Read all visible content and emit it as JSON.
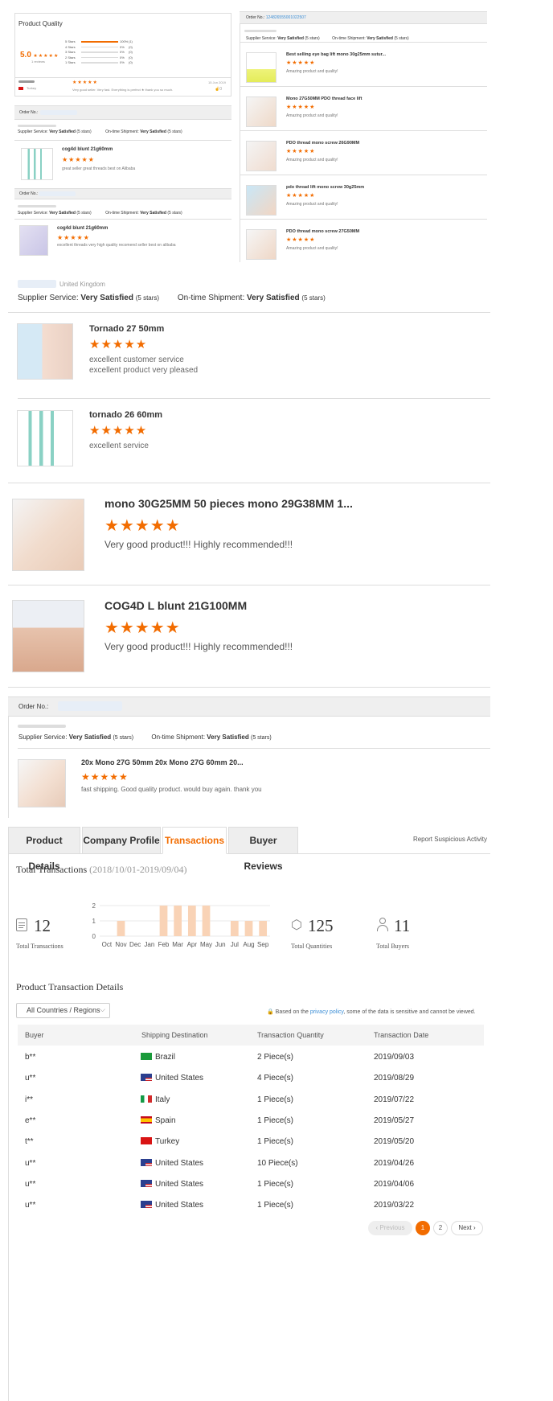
{
  "quality": {
    "title": "Product Quality",
    "score": "5.0",
    "stars": "★★★★★",
    "count": "1 reviews",
    "bars": [
      {
        "label": "5 Stars",
        "pct": "100%",
        "count": "(1)",
        "fill": 1.0
      },
      {
        "label": "4 Stars",
        "pct": "0%",
        "count": "(0)",
        "fill": 0
      },
      {
        "label": "3 Stars",
        "pct": "0%",
        "count": "(0)",
        "fill": 0
      },
      {
        "label": "2 Stars",
        "pct": "0%",
        "count": "(0)",
        "fill": 0
      },
      {
        "label": "1 Stars",
        "pct": "0%",
        "count": "(0)",
        "fill": 0
      }
    ],
    "review_stars": "★★★★★",
    "review_text": "Very good seller. Very fast. Everything is perfect ★ thank you so much.",
    "review_country": "Turkey",
    "review_date": "15 Jun 2019",
    "review_likes": "0"
  },
  "left_orders": [
    {
      "order_label": "Order No.:",
      "supplier_label": "Supplier Service:",
      "supplier_value": "Very Satisfied",
      "supplier_stars": "(5 stars)",
      "ship_label": "On-time Shipment:",
      "ship_value": "Very Satisfied",
      "ship_stars": "(5 stars)",
      "product": "cog4d blunt 21g60mm",
      "stars": "★★★★★",
      "text": "great seller great threads  best on Alibaba"
    },
    {
      "order_label": "Order No.:",
      "supplier_label": "Supplier Service:",
      "supplier_value": "Very Satisfied",
      "supplier_stars": "(5 stars)",
      "ship_label": "On-time Shipment:",
      "ship_value": "Very Satisfied",
      "ship_stars": "(5 stars)",
      "product": "cog4d blunt 21g60mm",
      "stars": "★★★★★",
      "text": "excellent threads very high quality recomend seller best on alibaba"
    }
  ],
  "right_order": {
    "order_label": "Order No.:",
    "order_number": "124826555001022507",
    "supplier_label": "Supplier Service:",
    "supplier_value": "Very Satisfied",
    "supplier_stars": "(5 stars)",
    "ship_label": "On-time Shipment:",
    "ship_value": "Very Satisfied",
    "ship_stars": "(5 stars)",
    "items": [
      {
        "product": "Best selling eye bag lift mono 30g25mm sutur...",
        "stars": "★★★★★",
        "text": "Amazing product and quality!"
      },
      {
        "product": "Mono 27G50MM PDO thread face lift",
        "stars": "★★★★★",
        "text": "Amazing product and quality!"
      },
      {
        "product": "PDO thread mono screw 26G90MM",
        "stars": "★★★★★",
        "text": "Amazing product and quality!"
      },
      {
        "product": "pdo thread lift mono screw 30g25mm",
        "stars": "★★★★★",
        "text": "Amazing product and quality!"
      },
      {
        "product": "PDO thread mono screw 27G50MM",
        "stars": "★★★★★",
        "text": "Amazing product and quality!"
      }
    ]
  },
  "uk_review": {
    "country": "United Kingdom",
    "supplier_label": "Supplier Service:",
    "supplier_value": "Very Satisfied",
    "supplier_stars": "(5 stars)",
    "ship_label": "On-time Shipment:",
    "ship_value": "Very Satisfied",
    "ship_stars": "(5 stars)",
    "items": [
      {
        "product": "Tornado 27 50mm",
        "stars": "★★★★★",
        "line1": "excellent customer service",
        "line2": "excellent product very pleased"
      },
      {
        "product": "tornado 26 60mm",
        "stars": "★★★★★",
        "line1": "excellent service",
        "line2": ""
      }
    ]
  },
  "large_reviews": [
    {
      "product": "mono 30G25MM 50 pieces mono 29G38MM 1...",
      "stars": "★★★★★",
      "text": "Very good product!!! Highly recommended!!!"
    },
    {
      "product": "COG4D L blunt 21G100MM",
      "stars": "★★★★★",
      "text": "Very good product!!! Highly recommended!!!"
    }
  ],
  "last_order": {
    "order_label": "Order No.:",
    "supplier_label": "Supplier Service:",
    "supplier_value": "Very Satisfied",
    "supplier_stars": "(5 stars)",
    "ship_label": "On-time Shipment:",
    "ship_value": "Very Satisfied",
    "ship_stars": "(5 stars)",
    "product": "20x Mono 27G 50mm 20x Mono 27G 60mm 20...",
    "stars": "★★★★★",
    "text": "fast shipping. Good quality product. would buy again. thank you"
  },
  "tabs": [
    "Product Details",
    "Company Profile",
    "Transactions",
    "Buyer Reviews"
  ],
  "active_tab": "Transactions",
  "report_link": "Report Suspicious Activity",
  "transactions": {
    "title": "Total Transactions",
    "range": "(2018/10/01-2019/09/04)",
    "total": "12",
    "total_label": "Total Transactions",
    "quantities": "125",
    "quantities_label": "Total Quantities",
    "buyers": "11",
    "buyers_label": "Total Buyers"
  },
  "chart_data": {
    "type": "bar",
    "categories": [
      "Oct",
      "Nov",
      "Dec",
      "Jan",
      "Feb",
      "Mar",
      "Apr",
      "May",
      "Jun",
      "Jul",
      "Aug",
      "Sep"
    ],
    "values": [
      0,
      1,
      0,
      0,
      2,
      2,
      2,
      2,
      0,
      1,
      1,
      1
    ],
    "yticks": [
      "0",
      "1",
      "2"
    ],
    "ylim": [
      0,
      2
    ],
    "grid": true,
    "bar_color": "#f9d3b6"
  },
  "details": {
    "title": "Product Transaction Details",
    "filter": "All Countries / Regions",
    "notice_pre": "Based on the",
    "notice_link": "privacy policy",
    "notice_post": ", some of the data is sensitive and cannot be viewed.",
    "headers": [
      "Buyer",
      "Shipping Destination",
      "Transaction Quantity",
      "Transaction Date"
    ],
    "rows": [
      {
        "buyer": "b**",
        "flag": "brazil",
        "dest": "Brazil",
        "qty": "2 Piece(s)",
        "date": "2019/09/03"
      },
      {
        "buyer": "u**",
        "flag": "usa",
        "dest": "United States",
        "qty": "4 Piece(s)",
        "date": "2019/08/29"
      },
      {
        "buyer": "i**",
        "flag": "italy",
        "dest": "Italy",
        "qty": "1 Piece(s)",
        "date": "2019/07/22"
      },
      {
        "buyer": "e**",
        "flag": "spain",
        "dest": "Spain",
        "qty": "1 Piece(s)",
        "date": "2019/05/27"
      },
      {
        "buyer": "t**",
        "flag": "turkey",
        "dest": "Turkey",
        "qty": "1 Piece(s)",
        "date": "2019/05/20"
      },
      {
        "buyer": "u**",
        "flag": "usa",
        "dest": "United States",
        "qty": "10 Piece(s)",
        "date": "2019/04/26"
      },
      {
        "buyer": "u**",
        "flag": "usa",
        "dest": "United States",
        "qty": "1 Piece(s)",
        "date": "2019/04/06"
      },
      {
        "buyer": "u**",
        "flag": "usa",
        "dest": "United States",
        "qty": "1 Piece(s)",
        "date": "2019/03/22"
      }
    ]
  },
  "pagination": {
    "previous": "Previous",
    "pages": [
      "1",
      "2"
    ],
    "current": "1",
    "next": "Next"
  },
  "colors": {
    "accent": "#f26c00",
    "link": "#3d8fd6",
    "border": "#dddddd",
    "header_bg": "#efefef"
  }
}
